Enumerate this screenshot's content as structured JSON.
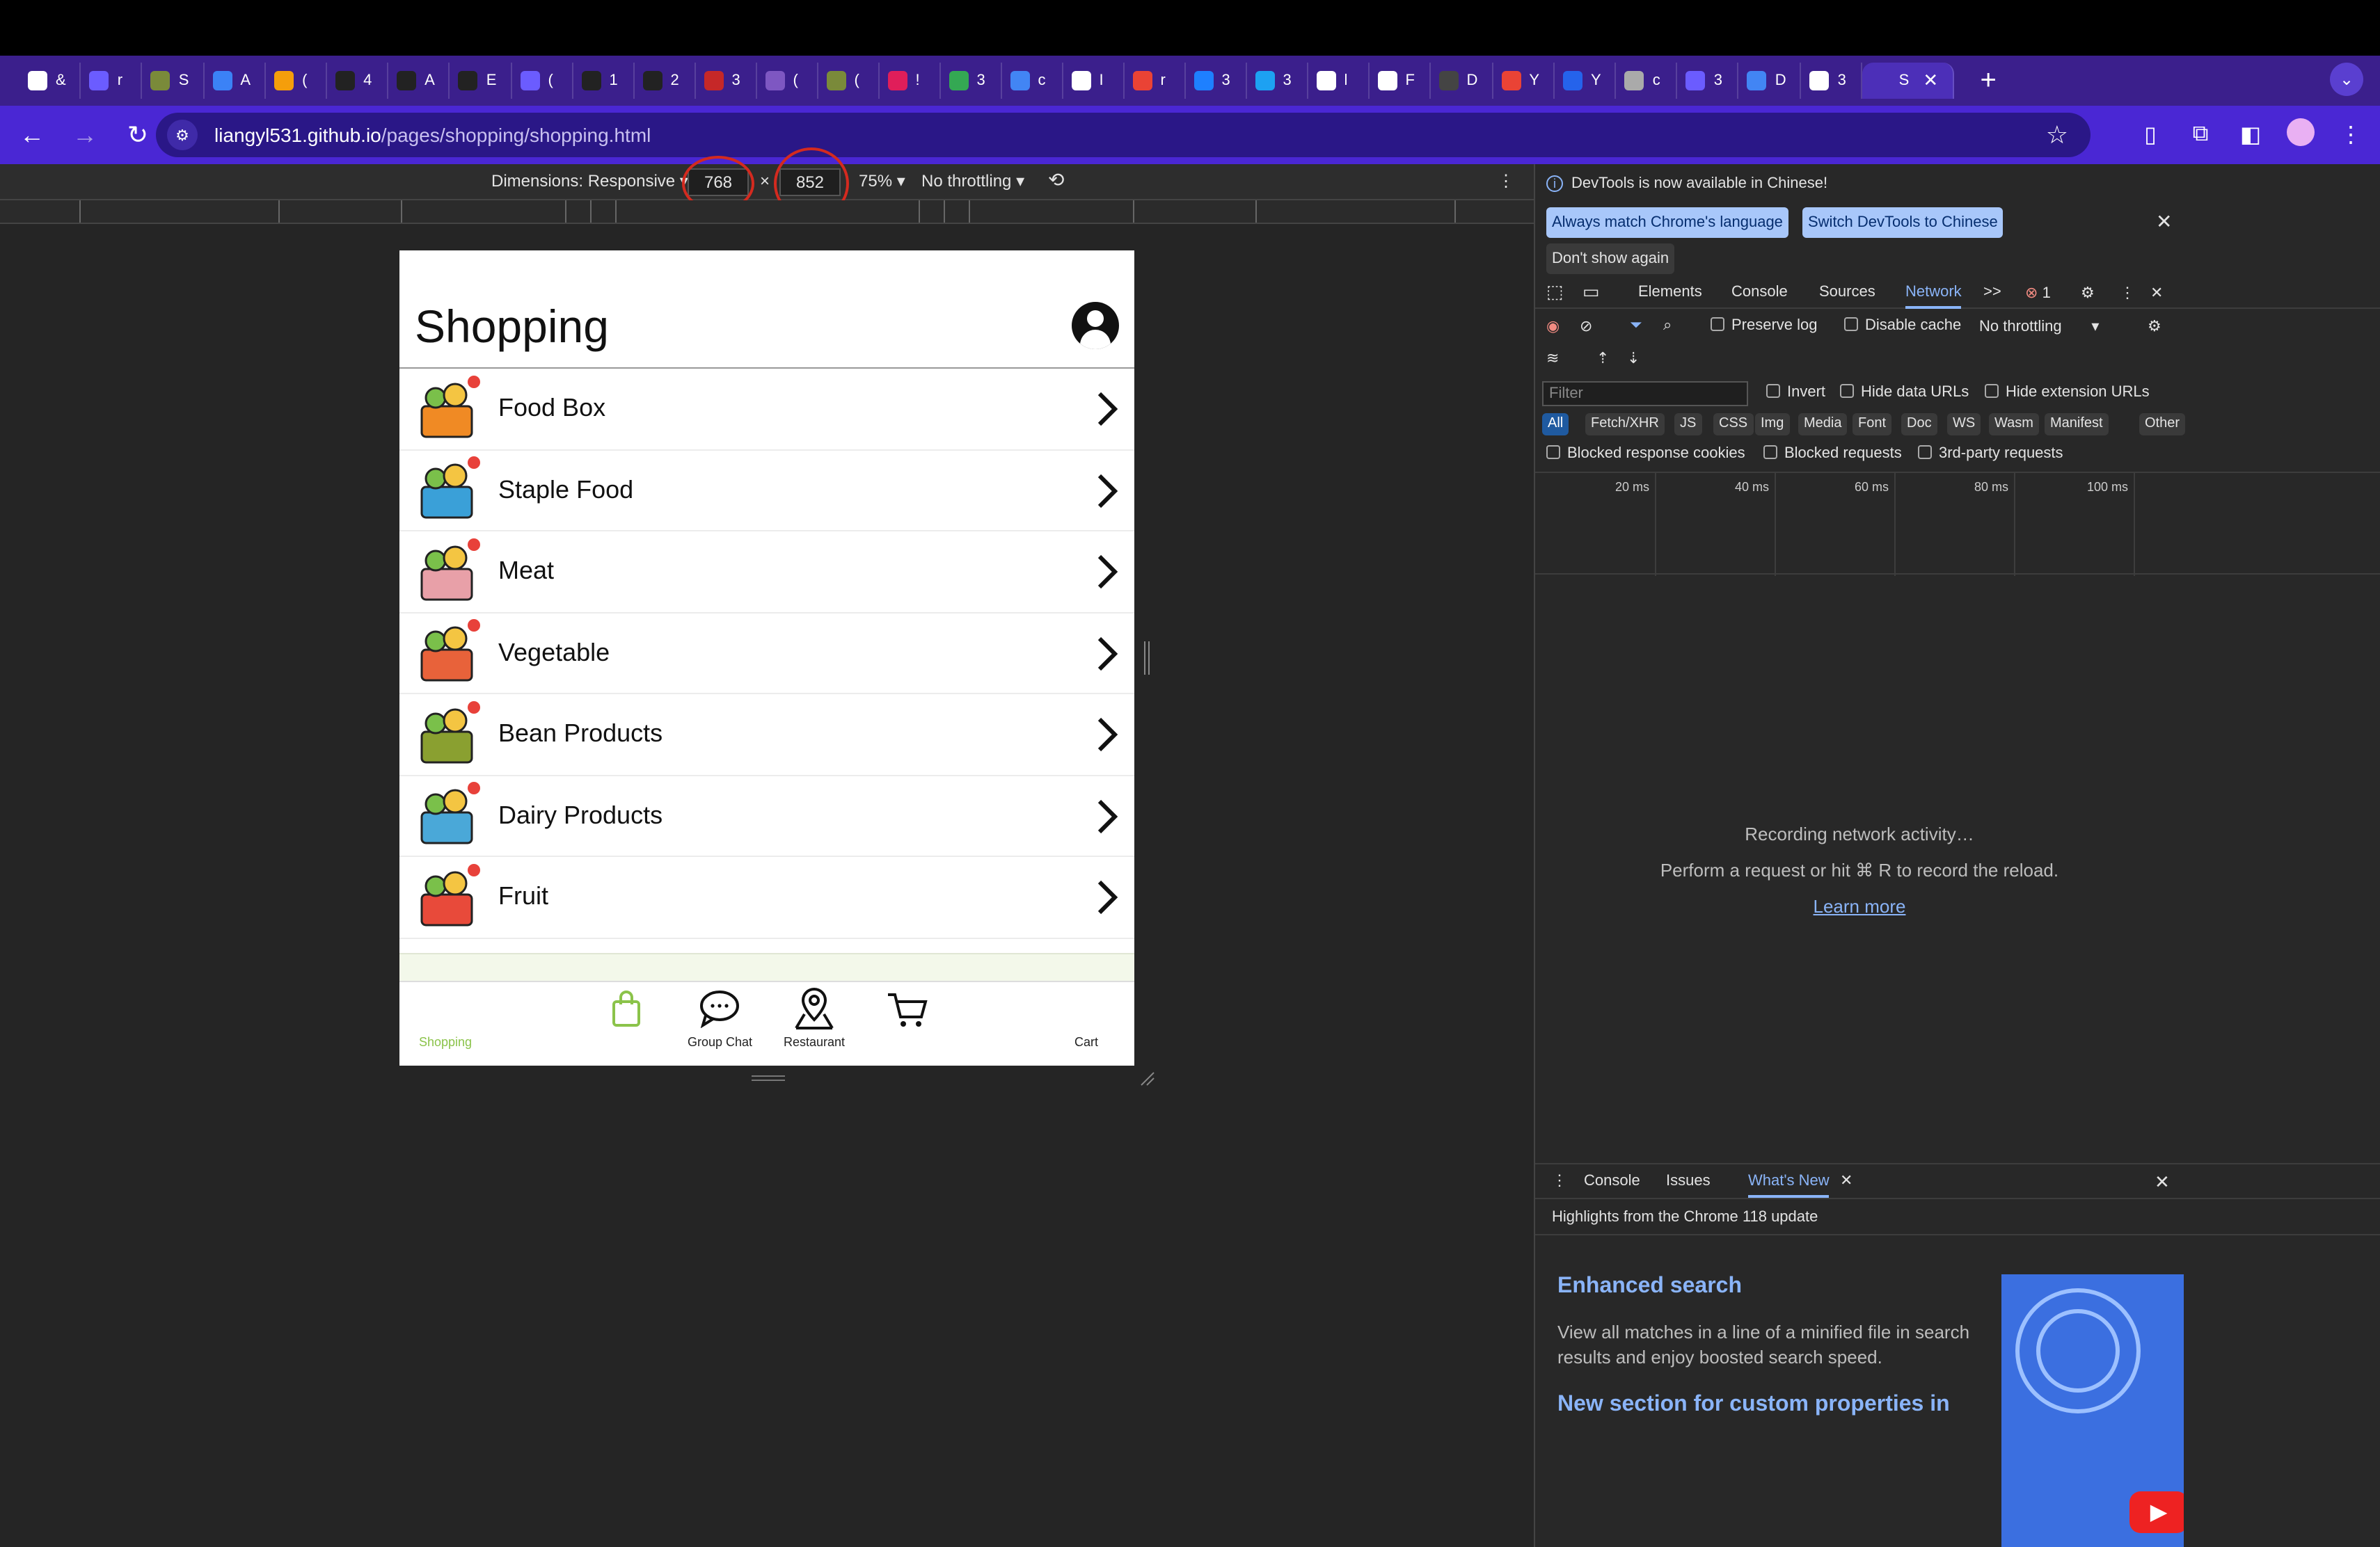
{
  "browser": {
    "tabs": [
      {
        "label": "&",
        "icon": "github-icon",
        "color": "#ffffff"
      },
      {
        "label": "r",
        "icon": "shield-icon",
        "color": "#6b5cff"
      },
      {
        "label": "S",
        "icon": "shield-icon",
        "color": "#7a8a3a"
      },
      {
        "label": "A",
        "icon": "text-icon",
        "color": "#3b82f6"
      },
      {
        "label": "(",
        "icon": "chart-icon",
        "color": "#f59e0b"
      },
      {
        "label": "4",
        "icon": "bb-icon",
        "color": "#222222"
      },
      {
        "label": "A",
        "icon": "bb-icon",
        "color": "#222222"
      },
      {
        "label": "E",
        "icon": "bb-icon",
        "color": "#222222"
      },
      {
        "label": "(",
        "icon": "shield-icon",
        "color": "#6b5cff"
      },
      {
        "label": "1",
        "icon": "bb-icon",
        "color": "#222222"
      },
      {
        "label": "2",
        "icon": "bb-icon",
        "color": "#222222"
      },
      {
        "label": "3",
        "icon": "pb-icon",
        "color": "#c62828"
      },
      {
        "label": "(",
        "icon": "ed-icon",
        "color": "#7e57c2"
      },
      {
        "label": "(",
        "icon": "shield-icon",
        "color": "#7a8a3a"
      },
      {
        "label": "!",
        "icon": "slack-icon",
        "color": "#e01e5a"
      },
      {
        "label": "3",
        "icon": "drive-icon",
        "color": "#34a853"
      },
      {
        "label": "c",
        "icon": "doc-icon",
        "color": "#4285f4"
      },
      {
        "label": "I",
        "icon": "github-icon",
        "color": "#ffffff"
      },
      {
        "label": "r",
        "icon": "google-icon",
        "color": "#ea4335"
      },
      {
        "label": "3",
        "icon": "zhihu-icon",
        "color": "#1e80ff"
      },
      {
        "label": "3",
        "icon": "bird-icon",
        "color": "#1da1f2"
      },
      {
        "label": "l",
        "icon": "calc-icon",
        "color": "#ffffff"
      },
      {
        "label": "F",
        "icon": "github-icon",
        "color": "#ffffff"
      },
      {
        "label": "D",
        "icon": "openai-icon",
        "color": "#444444"
      },
      {
        "label": "Y",
        "icon": "gmail-icon",
        "color": "#ea4335"
      },
      {
        "label": "Y",
        "icon": "edge-icon",
        "color": "#2563eb"
      },
      {
        "label": "c",
        "icon": "globe-icon",
        "color": "#aaaaaa"
      },
      {
        "label": "3",
        "icon": "shield-icon",
        "color": "#6b5cff"
      },
      {
        "label": "D",
        "icon": "doc-icon",
        "color": "#4285f4"
      },
      {
        "label": "3",
        "icon": "gear-icon",
        "color": "#ffffff"
      },
      {
        "label": "S",
        "icon": "active-tab",
        "color": "#4c2fb8"
      }
    ],
    "new_tab": "+",
    "url_host": "liangyl531.github.io",
    "url_path": "/pages/shopping/shopping.html"
  },
  "device_toolbar": {
    "dimensions_label": "Dimensions: Responsive",
    "width": "768",
    "times": "×",
    "height": "852",
    "zoom": "75%",
    "throttling": "No throttling"
  },
  "app": {
    "title": "Shopping",
    "categories": [
      {
        "label": "Food Box",
        "icon": "food-box-icon"
      },
      {
        "label": "Staple Food",
        "icon": "staple-food-icon"
      },
      {
        "label": "Meat",
        "icon": "meat-icon"
      },
      {
        "label": "Vegetable",
        "icon": "vegetable-icon"
      },
      {
        "label": "Bean Products",
        "icon": "bean-icon"
      },
      {
        "label": "Dairy Products",
        "icon": "dairy-icon"
      },
      {
        "label": "Fruit",
        "icon": "fruit-icon"
      }
    ],
    "bottom_nav": {
      "shopping": "Shopping",
      "group_chat": "Group Chat",
      "restaurant": "Restaurant",
      "cart": "Cart"
    },
    "accent_color": "#8bc34a"
  },
  "devtools": {
    "banner": "DevTools is now available in Chinese!",
    "btn_match": "Always match Chrome's language",
    "btn_switch": "Switch DevTools to Chinese",
    "btn_dont_show": "Don't show again",
    "tabs": [
      "Elements",
      "Console",
      "Sources",
      "Network"
    ],
    "more_tabs": ">>",
    "error_count": "1",
    "preserve_log": "Preserve log",
    "disable_cache": "Disable cache",
    "throttling": "No throttling",
    "filter_placeholder": "Filter",
    "invert": "Invert",
    "hide_data_urls": "Hide data URLs",
    "hide_ext_urls": "Hide extension URLs",
    "chips": [
      "All",
      "Fetch/XHR",
      "JS",
      "CSS",
      "Img",
      "Media",
      "Font",
      "Doc",
      "WS",
      "Wasm",
      "Manifest",
      "Other"
    ],
    "blocked_cookies": "Blocked response cookies",
    "blocked_requests": "Blocked requests",
    "third_party": "3rd-party requests",
    "ticks": [
      "20 ms",
      "40 ms",
      "60 ms",
      "80 ms",
      "100 ms"
    ],
    "recording": "Recording network activity…",
    "perform": "Perform a request or hit ⌘ R to record the reload.",
    "learn_more": "Learn more",
    "drawer_tabs": [
      "Console",
      "Issues",
      "What's New"
    ],
    "highlights": "Highlights from the Chrome 118 update",
    "wn1_title": "Enhanced search",
    "wn1_text": "View all matches in a line of a minified file in search results and enjoy boosted search speed.",
    "wn2_title": "New section for custom properties in"
  }
}
